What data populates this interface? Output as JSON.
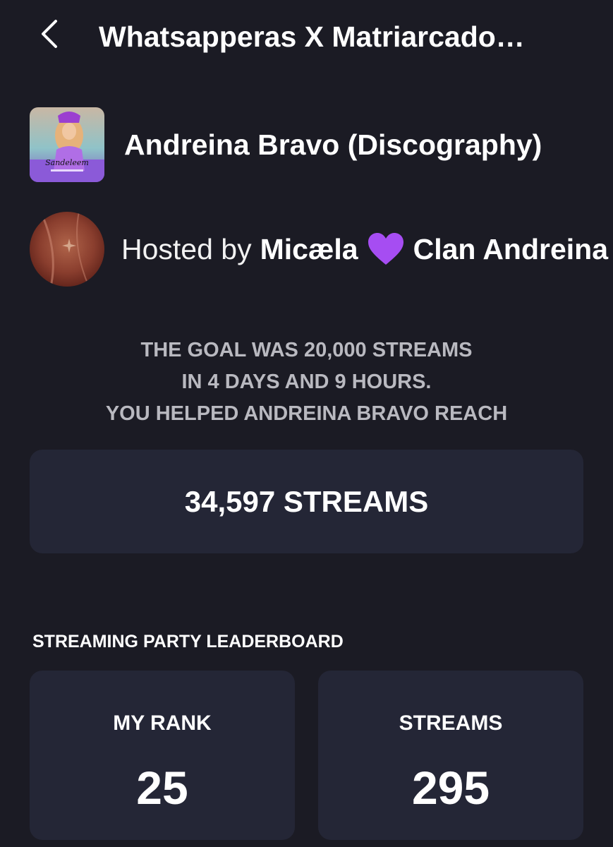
{
  "header": {
    "title": "Whatsapperas X Matriarcado…"
  },
  "playlist": {
    "title": "Andreina Bravo (Discography)",
    "cover_text": "Sandeleem"
  },
  "host": {
    "prefix": "Hosted by",
    "name": "Micæla",
    "heart_icon": "purple-heart-icon",
    "heart_color": "#a64df2",
    "clan": "Clan Andreina"
  },
  "goal": {
    "line1": "THE GOAL WAS 20,000 STREAMS",
    "line2": "IN 4 DAYS AND 9 HOURS.",
    "line3": "YOU HELPED ANDREINA BRAVO REACH"
  },
  "result": {
    "streams_total": "34,597 STREAMS"
  },
  "leaderboard": {
    "heading": "STREAMING PARTY LEADERBOARD",
    "rank_label": "MY RANK",
    "rank_value": "25",
    "streams_label": "STREAMS",
    "streams_value": "295"
  },
  "colors": {
    "background": "#1b1b24",
    "card": "#242636",
    "muted_text": "#b9b9c0"
  }
}
